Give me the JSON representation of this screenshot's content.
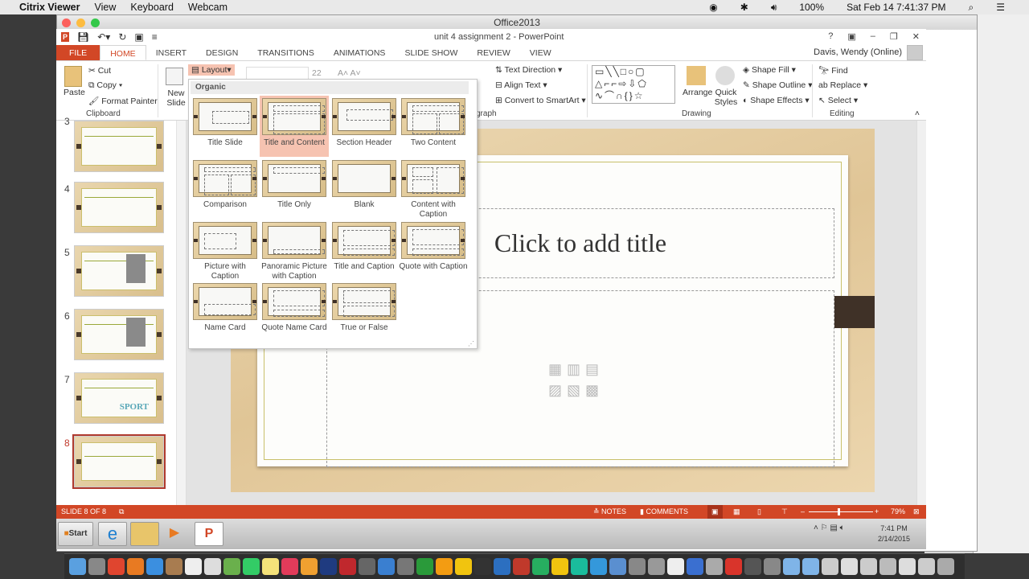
{
  "menubar": {
    "app": "Citrix Viewer",
    "items": [
      "View",
      "Keyboard",
      "Webcam"
    ],
    "battery": "100%",
    "datetime": "Sat Feb 14  7:41:37 PM"
  },
  "outer_window": {
    "title": "Office2013"
  },
  "ppt": {
    "doc_title": "unit 4 assignment 2 - PowerPoint",
    "user": "Davis, Wendy (Online)",
    "help": "?",
    "minimize": "–",
    "restore": "❐",
    "close": "✕"
  },
  "tabs": [
    "FILE",
    "HOME",
    "INSERT",
    "DESIGN",
    "TRANSITIONS",
    "ANIMATIONS",
    "SLIDE SHOW",
    "REVIEW",
    "VIEW"
  ],
  "ribbon": {
    "clipboard": {
      "paste": "Paste",
      "cut": "Cut",
      "copy": "Copy",
      "format_painter": "Format Painter",
      "group": "Clipboard"
    },
    "slides": {
      "new_slide": "New Slide",
      "layout": "Layout"
    },
    "font": {
      "size": "22"
    },
    "paragraph": {
      "text_direction": "Text Direction",
      "align_text": "Align Text",
      "convert": "Convert to SmartArt",
      "group": "graph"
    },
    "drawing": {
      "arrange": "Arrange",
      "quick_styles": "Quick Styles",
      "shape_fill": "Shape Fill",
      "shape_outline": "Shape Outline",
      "shape_effects": "Shape Effects",
      "group": "Drawing"
    },
    "editing": {
      "find": "Find",
      "replace": "Replace",
      "select": "Select",
      "group": "Editing"
    }
  },
  "layout_menu": {
    "theme": "Organic",
    "selected": "Title and Content",
    "items": [
      "Title Slide",
      "Title and Content",
      "Section Header",
      "Two Content",
      "Comparison",
      "Title Only",
      "Blank",
      "Content with Caption",
      "Picture with Caption",
      "Panoramic Picture with Caption",
      "Title and Caption",
      "Quote with Caption",
      "Name Card",
      "Quote Name Card",
      "True or False"
    ]
  },
  "thumbnails": {
    "numbers": [
      "3",
      "4",
      "5",
      "6",
      "7",
      "8"
    ],
    "selected": "8",
    "sport_logo": "SPORT"
  },
  "slide": {
    "title_placeholder": "Click to add title"
  },
  "status": {
    "slide": "SLIDE 8 OF 8",
    "notes": "NOTES",
    "comments": "COMMENTS",
    "zoom": "79%",
    "zoom_fraction": 0.45
  },
  "taskbar": {
    "start": "Start",
    "time": "7:41 PM",
    "date": "2/14/2015"
  },
  "dock": {
    "colors": [
      "#5aa0e0",
      "#888",
      "#e0452f",
      "#e87a22",
      "#3b8fe0",
      "#a87c50",
      "#eee",
      "#ddd",
      "#6ab04c",
      "#3c6",
      "#f5e27a",
      "#e23b5a",
      "#f0a030",
      "#1f3b80",
      "#c0282d",
      "#666",
      "#3a7fd0",
      "#777",
      "#2a9a3a",
      "#f39c12",
      "#f1c40f",
      "#333",
      "#2c6fc0",
      "#c0392b",
      "#27ae60",
      "#f1c40f",
      "#1abc9c",
      "#3498db",
      "#5a8fd0",
      "#888",
      "#999",
      "#eee",
      "#3a6fd0",
      "#aaa",
      "#d9342b",
      "#555",
      "#888",
      "#7fb4e8",
      "#7fb4e8",
      "#ccc",
      "#ddd",
      "#ccc",
      "#bbb",
      "#ddd",
      "#ccc",
      "#aaa"
    ]
  },
  "colors": {
    "accent": "#d24726",
    "wood": "#e0c596",
    "frame_tab": "#3f3127"
  }
}
